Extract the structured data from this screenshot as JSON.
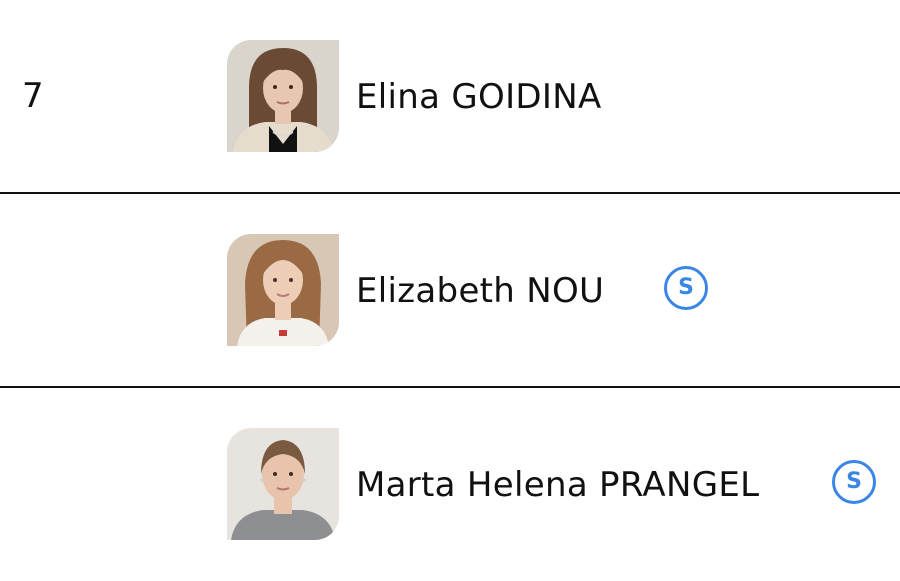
{
  "athletes": [
    {
      "rank": "7",
      "name": "Elina GOIDINA",
      "badge": "",
      "photo_bg": "#d9d4cc",
      "hair_color": "#6b4a33",
      "skin_color": "#e8c7b1",
      "top_color": "#111111",
      "jacket_color": "#e6dccd"
    },
    {
      "rank": "",
      "name": "Elizabeth NOU",
      "badge": "S",
      "photo_bg": "#d8c7b5",
      "hair_color": "#9a6a45",
      "skin_color": "#edcdb6",
      "top_color": "#f4f0ec",
      "jacket_color": "#f4f0ec"
    },
    {
      "rank": "",
      "name": "Marta Helena PRANGEL",
      "badge": "S",
      "photo_bg": "#e7e4df",
      "hair_color": "#7a5a40",
      "skin_color": "#e9c4ad",
      "top_color": "#8d8f93",
      "jacket_color": "#8d8f93"
    }
  ],
  "colors": {
    "badge_accent": "#3a86e4",
    "divider": "#111111",
    "text": "#111111"
  }
}
